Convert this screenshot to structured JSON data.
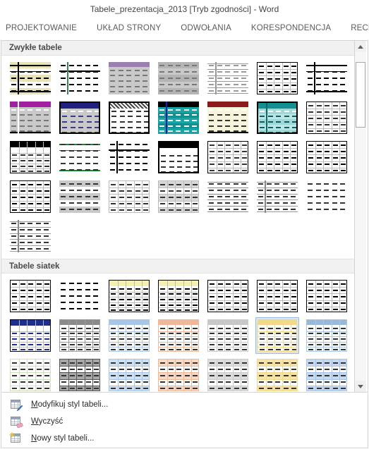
{
  "window": {
    "title": "Tabele_prezentacja_2013 [Tryb zgodności] - Word"
  },
  "ribbon": {
    "tabs": [
      {
        "label": "PROJEKTOWANIE"
      },
      {
        "label": "UKŁAD STRONY"
      },
      {
        "label": "ODWOŁANIA"
      },
      {
        "label": "KORESPONDENCJA"
      },
      {
        "label": "RECENZJA"
      }
    ]
  },
  "gallery": {
    "sections": [
      {
        "title": "Zwykłe tabele",
        "items": [
          {
            "name": "tabela-zwykla-1",
            "head": "none",
            "headColor": "",
            "bodyFill": "#ffffff",
            "border": "heavy-h",
            "accent": "#000000",
            "bandFill": "#e8e2b8",
            "banded": true,
            "firstColBar": "#000000"
          },
          {
            "name": "tabela-zwykla-2",
            "head": "none",
            "headColor": "",
            "bodyFill": "#ffffff",
            "border": "t-shape",
            "accent": "#000000",
            "bandFill": "",
            "banded": false,
            "firstColBar": "#2e8b4f"
          },
          {
            "name": "tabela-zwykla-3",
            "head": "thin",
            "headColor": "#9b7fb0",
            "bodyFill": "#c9c9c9",
            "border": "none",
            "accent": "#777777",
            "bandFill": "",
            "banded": false,
            "firstColBar": ""
          },
          {
            "name": "tabela-zwykla-4",
            "head": "none",
            "headColor": "",
            "bodyFill": "#c9c9c9",
            "border": "none",
            "accent": "#777777",
            "bandFill": "#b4b4b4",
            "banded": true,
            "firstColBar": ""
          },
          {
            "name": "tabela-zwykla-5",
            "head": "none",
            "headColor": "",
            "bodyFill": "#ffffff",
            "border": "light-h",
            "accent": "#9a9a9a",
            "bandFill": "",
            "banded": false,
            "firstColBar": "#9a9a9a"
          },
          {
            "name": "tabela-zwykla-6",
            "head": "none",
            "headColor": "",
            "bodyFill": "#ffffff",
            "border": "box-grid",
            "accent": "#000000",
            "bandFill": "",
            "banded": false,
            "firstColBar": ""
          },
          {
            "name": "tabela-zwykla-7",
            "head": "none",
            "headColor": "",
            "bodyFill": "#ffffff",
            "border": "heavy-h",
            "accent": "#000000",
            "bandFill": "",
            "banded": false,
            "firstColBar": "#000000"
          },
          {
            "name": "tabela-zwykla-8",
            "head": "solid",
            "headColor": "#a020a0",
            "bodyFill": "#c9c9c9",
            "border": "bottom",
            "accent": "#777777",
            "bandFill": "",
            "banded": false,
            "firstColBar": "#ffffff"
          },
          {
            "name": "tabela-zwykla-9",
            "head": "solid",
            "headColor": "#202080",
            "bodyFill": "#c9c9c9",
            "border": "box",
            "accent": "#3a3a8a",
            "bandFill": "",
            "banded": false,
            "firstColBar": ""
          },
          {
            "name": "tabela-zwykla-10",
            "head": "checker",
            "headColor": "#555555",
            "bodyFill": "#ffffff",
            "border": "box",
            "accent": "#333333",
            "bandFill": "",
            "banded": false,
            "firstColBar": ""
          },
          {
            "name": "tabela-zwykla-11",
            "head": "solid",
            "headColor": "#000000",
            "bodyFill": "#148f8f",
            "border": "none",
            "accent": "#ffffff",
            "bandFill": "#17a5a5",
            "banded": true,
            "firstColBar": "#1b1bb0"
          },
          {
            "name": "tabela-zwykla-12",
            "head": "solid",
            "headColor": "#8b1a1a",
            "bodyFill": "#f7f4dc",
            "border": "bottom",
            "accent": "#333333",
            "bandFill": "",
            "banded": false,
            "firstColBar": ""
          },
          {
            "name": "tabela-zwykla-13",
            "head": "solid",
            "headColor": "#148f8f",
            "bodyFill": "#bfe6e6",
            "border": "box",
            "accent": "#0c5f5f",
            "bandFill": "#9fd8d8",
            "banded": true,
            "firstColBar": "#0d6b6b"
          },
          {
            "name": "tabela-zwykla-14",
            "head": "none",
            "headColor": "",
            "bodyFill": "#ffffff",
            "border": "box-grid",
            "accent": "#333333",
            "bandFill": "",
            "banded": false,
            "firstColBar": ""
          },
          {
            "name": "tabela-zwykla-15",
            "head": "solid",
            "headColor": "#000000",
            "bodyFill": "#ffffff",
            "border": "box-grid",
            "accent": "#333333",
            "bandFill": "",
            "banded": false,
            "firstColBar": ""
          },
          {
            "name": "tabela-zwykla-16",
            "head": "none",
            "headColor": "",
            "bodyFill": "#ffffff",
            "border": "heavy-h",
            "accent": "#333333",
            "bandFill": "",
            "banded": false,
            "firstColBar": "",
            "lineColor": "#168a2e"
          },
          {
            "name": "tabela-zwykla-17",
            "head": "none",
            "headColor": "",
            "bodyFill": "#ffffff",
            "border": "t-shape",
            "accent": "#000000",
            "bandFill": "",
            "banded": false,
            "firstColBar": "#000000"
          },
          {
            "name": "tabela-zwykla-18",
            "head": "solid",
            "headColor": "#000000",
            "bodyFill": "#ffffff",
            "border": "box",
            "accent": "#333333",
            "bandFill": "",
            "banded": false,
            "firstColBar": ""
          },
          {
            "name": "tabela-zwykla-19",
            "head": "none",
            "headColor": "",
            "bodyFill": "#ffffff",
            "border": "box-grid",
            "accent": "#333333",
            "bandFill": "",
            "banded": false,
            "firstColBar": ""
          },
          {
            "name": "tabela-zwykla-20",
            "head": "none",
            "headColor": "",
            "bodyFill": "#ffffff",
            "border": "box-grid",
            "accent": "#000000",
            "bandFill": "",
            "banded": false,
            "firstColBar": ""
          },
          {
            "name": "tabela-zwykla-21",
            "head": "none",
            "headColor": "",
            "bodyFill": "#ffffff",
            "border": "box-grid",
            "accent": "#000000",
            "bandFill": "",
            "banded": false,
            "firstColBar": ""
          },
          {
            "name": "tabela-zwykla-22",
            "head": "none",
            "headColor": "",
            "bodyFill": "#ffffff",
            "border": "box-grid",
            "accent": "#000000",
            "bandFill": "",
            "banded": false,
            "firstColBar": ""
          },
          {
            "name": "tabela-zwykla-23",
            "head": "none",
            "headColor": "",
            "bodyFill": "#ffffff",
            "border": "none",
            "accent": "#333333",
            "bandFill": "#c9c9c9",
            "banded": true,
            "firstColBar": ""
          },
          {
            "name": "tabela-zwykla-24",
            "head": "none",
            "headColor": "",
            "bodyFill": "#ffffff",
            "border": "box-grid",
            "accent": "#333333",
            "bandFill": "",
            "banded": false,
            "firstColBar": "",
            "lineColor": "#bbbbbb"
          },
          {
            "name": "tabela-zwykla-25",
            "head": "none",
            "headColor": "",
            "bodyFill": "#ffffff",
            "border": "box-grid",
            "accent": "#333333",
            "bandFill": "#d8d8d8",
            "banded": true,
            "firstColBar": "",
            "lineColor": "#bbbbbb"
          },
          {
            "name": "tabela-zwykla-26",
            "head": "none",
            "headColor": "",
            "bodyFill": "#ffffff",
            "border": "light-h",
            "accent": "#333333",
            "bandFill": "",
            "banded": false,
            "firstColBar": "",
            "lineColor": "#888888"
          },
          {
            "name": "tabela-zwykla-27",
            "head": "none",
            "headColor": "",
            "bodyFill": "#ffffff",
            "border": "light-h",
            "accent": "#333333",
            "bandFill": "",
            "banded": false,
            "firstColBar": "#888888"
          },
          {
            "name": "tabela-zwykla-28",
            "head": "none",
            "headColor": "",
            "bodyFill": "#ffffff",
            "border": "none",
            "accent": "#333333",
            "bandFill": "",
            "banded": false,
            "firstColBar": ""
          },
          {
            "name": "tabela-zwykla-29",
            "head": "none",
            "headColor": "",
            "bodyFill": "#ffffff",
            "border": "light-h",
            "accent": "#333333",
            "bandFill": "",
            "banded": false,
            "firstColBar": "#888888"
          }
        ]
      },
      {
        "title": "Tabele siatek",
        "items": [
          {
            "name": "tabela-siatek-1",
            "head": "none",
            "headColor": "",
            "bodyFill": "#ffffff",
            "border": "box-grid",
            "accent": "#000000",
            "bandFill": "",
            "banded": false,
            "firstColBar": ""
          },
          {
            "name": "tabela-siatek-2",
            "head": "none",
            "headColor": "",
            "bodyFill": "#ffffff",
            "border": "none",
            "accent": "#000000",
            "bandFill": "",
            "banded": false,
            "firstColBar": ""
          },
          {
            "name": "tabela-siatek-3",
            "head": "tint",
            "headColor": "#f5f0b0",
            "bodyFill": "#ffffff",
            "border": "box-grid",
            "accent": "#000000",
            "bandFill": "",
            "banded": false,
            "firstColBar": ""
          },
          {
            "name": "tabela-siatek-4",
            "head": "tint",
            "headColor": "#f5f0b0",
            "bodyFill": "#ffffff",
            "border": "box-grid",
            "accent": "#000000",
            "bandFill": "",
            "banded": false,
            "firstColBar": ""
          },
          {
            "name": "tabela-siatek-5",
            "head": "none",
            "headColor": "",
            "bodyFill": "#ffffff",
            "border": "box-grid",
            "accent": "#000000",
            "bandFill": "",
            "banded": false,
            "firstColBar": ""
          },
          {
            "name": "tabela-siatek-6",
            "head": "none",
            "headColor": "",
            "bodyFill": "#ffffff",
            "border": "box-grid",
            "accent": "#000000",
            "bandFill": "",
            "banded": false,
            "firstColBar": ""
          },
          {
            "name": "tabela-siatek-7",
            "head": "none",
            "headColor": "",
            "bodyFill": "#ffffff",
            "border": "box-grid",
            "accent": "#000000",
            "bandFill": "",
            "banded": false,
            "firstColBar": ""
          },
          {
            "name": "tabela-siatek-8",
            "head": "solid",
            "headColor": "#1f2f8f",
            "bodyFill": "#ffffff",
            "border": "box-grid",
            "accent": "#1f2f8f",
            "bandFill": "",
            "banded": false,
            "firstColBar": ""
          },
          {
            "name": "tabela-siatek-9",
            "head": "thin",
            "headColor": "#8a8a8a",
            "bodyFill": "#ffffff",
            "border": "box-grid",
            "accent": "#333333",
            "bandFill": "",
            "banded": false,
            "firstColBar": "",
            "lineColor": "#9a9a9a"
          },
          {
            "name": "tabela-siatek-10",
            "head": "thin",
            "headColor": "#a8c6e8",
            "bodyFill": "#ffffff",
            "border": "box-grid",
            "accent": "#333333",
            "bandFill": "",
            "banded": false,
            "firstColBar": "",
            "lineColor": "#a8c6e8"
          },
          {
            "name": "tabela-siatek-11",
            "head": "thin",
            "headColor": "#f0b89a",
            "bodyFill": "#ffffff",
            "border": "box-grid",
            "accent": "#333333",
            "bandFill": "",
            "banded": false,
            "firstColBar": "",
            "lineColor": "#f0b89a"
          },
          {
            "name": "tabela-siatek-12",
            "head": "thin",
            "headColor": "#c8c8c8",
            "bodyFill": "#ffffff",
            "border": "box-grid",
            "accent": "#333333",
            "bandFill": "",
            "banded": false,
            "firstColBar": "",
            "lineColor": "#cccccc"
          },
          {
            "name": "tabela-siatek-13",
            "head": "thin",
            "headColor": "#f2d98a",
            "bodyFill": "#ffffff",
            "border": "box-grid",
            "accent": "#333333",
            "bandFill": "",
            "banded": false,
            "firstColBar": "",
            "lineColor": "#f2d98a",
            "selected": true
          },
          {
            "name": "tabela-siatek-14",
            "head": "thin",
            "headColor": "#9ab8d8",
            "bodyFill": "#ffffff",
            "border": "box-grid",
            "accent": "#333333",
            "bandFill": "",
            "banded": false,
            "firstColBar": "",
            "lineColor": "#a8c6e8"
          },
          {
            "name": "tabela-siatek-15",
            "head": "none",
            "headColor": "",
            "bodyFill": "#ffffff",
            "border": "box-grid",
            "accent": "#333333",
            "bandFill": "",
            "banded": false,
            "firstColBar": "",
            "lineColor": "#cfe0c0"
          },
          {
            "name": "tabela-siatek-16",
            "head": "none",
            "headColor": "",
            "bodyFill": "#ffffff",
            "border": "box-grid",
            "accent": "#333333",
            "bandFill": "#a8a8a8",
            "banded": true,
            "firstColBar": "",
            "lineColor": "#555555"
          },
          {
            "name": "tabela-siatek-17",
            "head": "none",
            "headColor": "",
            "bodyFill": "#ffffff",
            "border": "box-grid",
            "accent": "#333333",
            "bandFill": "#cfe0f2",
            "banded": true,
            "firstColBar": "",
            "lineColor": "#a8c6e8"
          },
          {
            "name": "tabela-siatek-18",
            "head": "none",
            "headColor": "",
            "bodyFill": "#ffffff",
            "border": "box-grid",
            "accent": "#333333",
            "bandFill": "#f7d9c6",
            "banded": true,
            "firstColBar": "",
            "lineColor": "#f0b89a"
          },
          {
            "name": "tabela-siatek-19",
            "head": "none",
            "headColor": "",
            "bodyFill": "#ffffff",
            "border": "box-grid",
            "accent": "#333333",
            "bandFill": "#dcdcdc",
            "banded": true,
            "firstColBar": "",
            "lineColor": "#cccccc"
          },
          {
            "name": "tabela-siatek-20",
            "head": "none",
            "headColor": "",
            "bodyFill": "#ffffff",
            "border": "box-grid",
            "accent": "#333333",
            "bandFill": "#f7e3a8",
            "banded": true,
            "firstColBar": "",
            "lineColor": "#f2d98a"
          },
          {
            "name": "tabela-siatek-21",
            "head": "none",
            "headColor": "",
            "bodyFill": "#ffffff",
            "border": "box-grid",
            "accent": "#333333",
            "bandFill": "#c6d9f0",
            "banded": true,
            "firstColBar": "",
            "lineColor": "#a8c6e8"
          }
        ]
      }
    ],
    "scrollbar": {
      "up_arrow": "scroll-up-arrow",
      "down_arrow": "scroll-down-arrow",
      "thumb_position_percent": 3,
      "thumb_size_percent": 20
    }
  },
  "menu": {
    "items": [
      {
        "name": "modify-table-style",
        "icon": "table-pencil-icon",
        "accel": "M",
        "rest": "odyfikuj styl tabeli..."
      },
      {
        "name": "clear-table-style",
        "icon": "table-eraser-icon",
        "accel": "W",
        "rest": "yczyść"
      },
      {
        "name": "new-table-style",
        "icon": "table-sparkle-icon",
        "accel": "N",
        "rest": "owy styl tabeli..."
      }
    ]
  }
}
